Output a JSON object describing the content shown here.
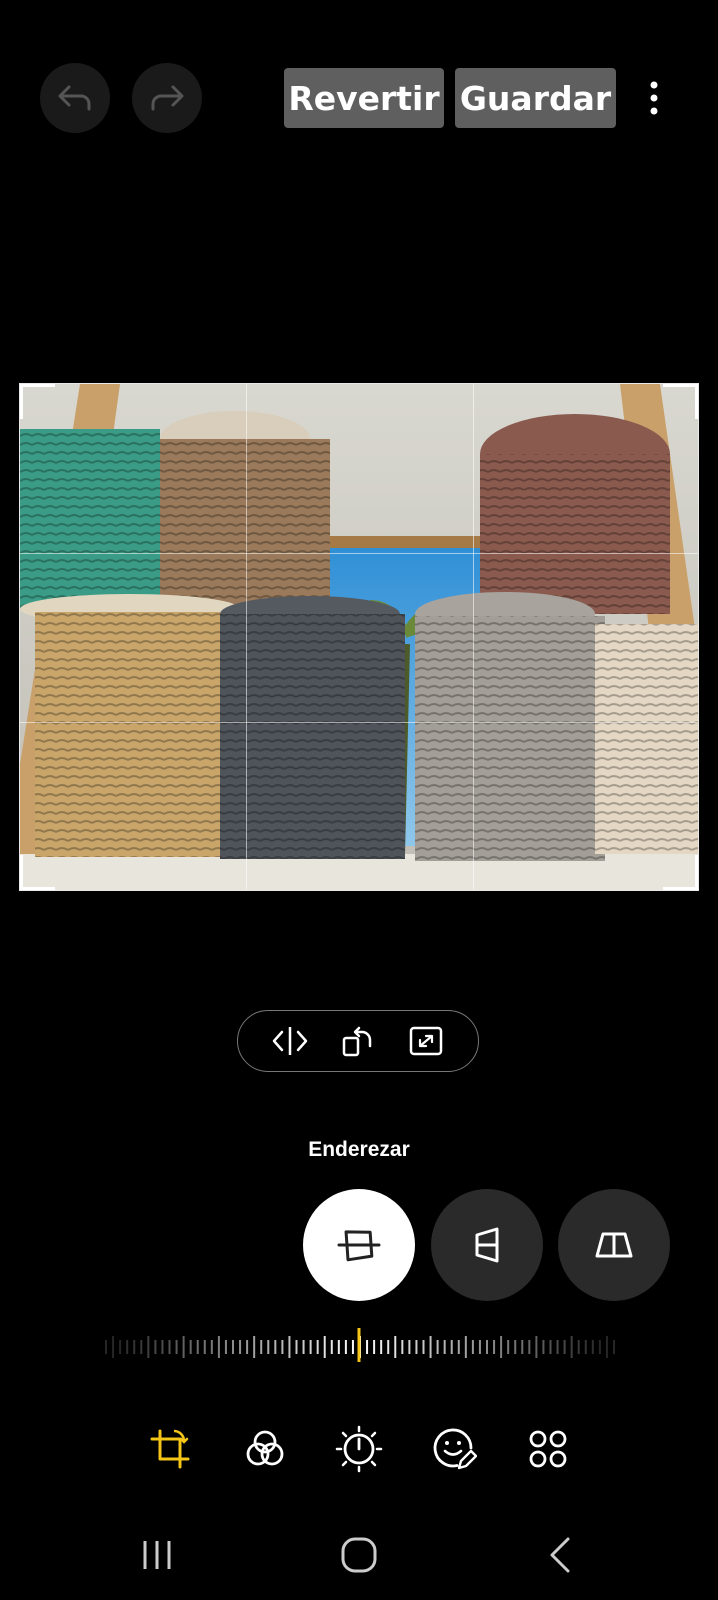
{
  "toolbar": {
    "undo_icon": "undo-arrow-icon",
    "redo_icon": "redo-arrow-icon",
    "revert_label": "Revertir",
    "save_label": "Guardar",
    "more_icon": "more-vertical-icon"
  },
  "transform_tools": [
    {
      "name": "flip-horizontal-icon"
    },
    {
      "name": "rotate-icon"
    },
    {
      "name": "expand-icon"
    }
  ],
  "straighten": {
    "label": "Enderezar",
    "modes": [
      {
        "name": "straighten-mode-icon",
        "active": true
      },
      {
        "name": "vertical-perspective-icon",
        "active": false
      },
      {
        "name": "horizontal-perspective-icon",
        "active": false
      }
    ],
    "slider_value": 0
  },
  "bottom_tools": [
    {
      "name": "crop-rotate-icon",
      "active": true
    },
    {
      "name": "filters-icon",
      "active": false
    },
    {
      "name": "brightness-icon",
      "active": false
    },
    {
      "name": "sticker-draw-icon",
      "active": false
    },
    {
      "name": "more-tools-icon",
      "active": false
    }
  ],
  "colors": {
    "accent": "#f5c518",
    "background": "#000000",
    "button_gray": "#5f5f5f"
  }
}
